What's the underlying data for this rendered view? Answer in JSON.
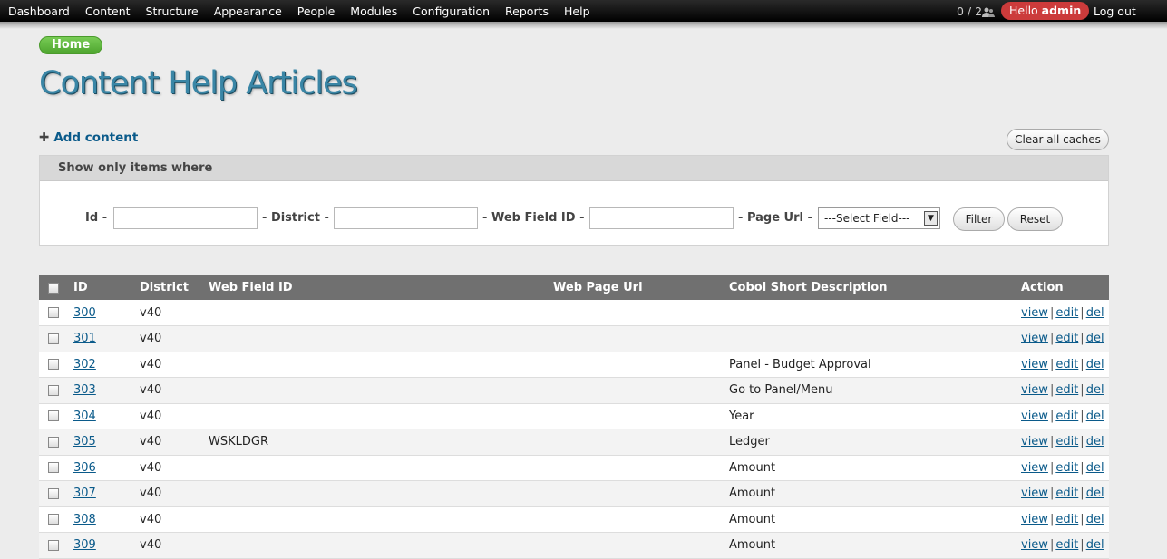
{
  "toolbar": {
    "menu": [
      "Dashboard",
      "Content",
      "Structure",
      "Appearance",
      "People",
      "Modules",
      "Configuration",
      "Reports",
      "Help"
    ],
    "counter": "0 / 2",
    "hello_prefix": "Hello",
    "hello_user": "admin",
    "logout": "Log out"
  },
  "breadcrumb": {
    "home": "Home"
  },
  "page": {
    "title": "Content Help Articles"
  },
  "actions": {
    "add_content": "Add content",
    "clear_caches": "Clear all caches"
  },
  "filter": {
    "legend": "Show only items where",
    "id_label": "Id",
    "district_label": "District",
    "webfield_label": "Web Field ID",
    "pageurl_label": "Page Url",
    "separator": "-",
    "select_value": "---Select Field---",
    "filter_button": "Filter",
    "reset_button": "Reset"
  },
  "table": {
    "headers": [
      "ID",
      "District",
      "Web Field ID",
      "Web Page Url",
      "Cobol Short Description",
      "Action"
    ],
    "action_labels": {
      "view": "view",
      "edit": "edit",
      "del": "del",
      "sep": "|"
    },
    "rows": [
      {
        "id": "300",
        "district": "v40",
        "web_field_id": "",
        "web_page_url": "",
        "desc": ""
      },
      {
        "id": "301",
        "district": "v40",
        "web_field_id": "",
        "web_page_url": "",
        "desc": ""
      },
      {
        "id": "302",
        "district": "v40",
        "web_field_id": "",
        "web_page_url": "",
        "desc": "Panel - Budget Approval"
      },
      {
        "id": "303",
        "district": "v40",
        "web_field_id": "",
        "web_page_url": "",
        "desc": "Go to Panel/Menu"
      },
      {
        "id": "304",
        "district": "v40",
        "web_field_id": "",
        "web_page_url": "",
        "desc": "Year"
      },
      {
        "id": "305",
        "district": "v40",
        "web_field_id": "WSKLDGR",
        "web_page_url": "",
        "desc": "Ledger"
      },
      {
        "id": "306",
        "district": "v40",
        "web_field_id": "",
        "web_page_url": "",
        "desc": "Amount"
      },
      {
        "id": "307",
        "district": "v40",
        "web_field_id": "",
        "web_page_url": "",
        "desc": "Amount"
      },
      {
        "id": "308",
        "district": "v40",
        "web_field_id": "",
        "web_page_url": "",
        "desc": "Amount"
      },
      {
        "id": "309",
        "district": "v40",
        "web_field_id": "",
        "web_page_url": "",
        "desc": "Amount"
      }
    ]
  }
}
